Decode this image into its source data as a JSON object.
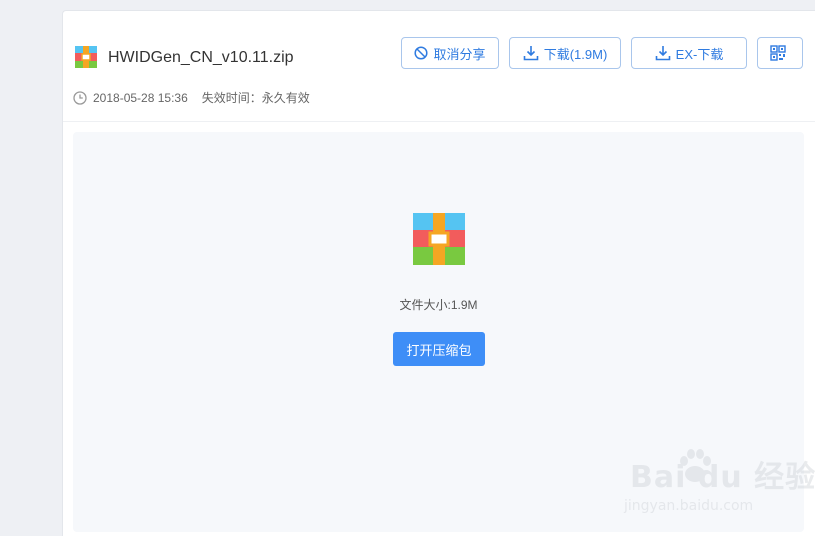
{
  "file": {
    "name": "HWIDGen_CN_v10.11.zip",
    "date": "2018-05-28 15:36",
    "expiry_label": "失效时间：",
    "expiry_value": "永久有效"
  },
  "toolbar": {
    "cancel_share_label": "取消分享",
    "download_label": "下载(1.9M)",
    "ex_download_label": "EX-下载"
  },
  "preview": {
    "size_label": "文件大小:1.9M",
    "open_label": "打开压缩包"
  },
  "watermark": {
    "brand": "Bai  du 经验",
    "url": "jingyan.baidu.com"
  },
  "colors": {
    "accent": "#3e8ef7",
    "outline": "#2f7be0"
  }
}
